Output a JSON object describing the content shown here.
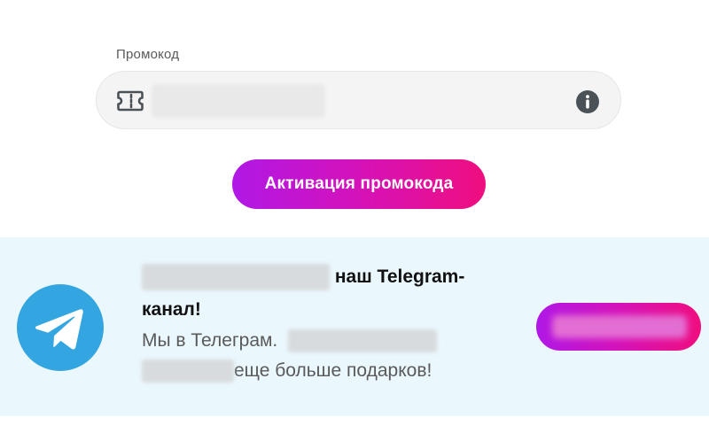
{
  "promo": {
    "label": "Промокод",
    "input_value": "",
    "ticket_icon": "ticket-icon",
    "info_icon": "info-icon"
  },
  "activate_button": {
    "label": "Активация промокода"
  },
  "telegram": {
    "title_visible": "наш Telegram-канал!",
    "desc_start": "Мы в Телеграм.",
    "desc_end": "еще больше подарков!",
    "logo_icon": "telegram-logo-icon"
  },
  "colors": {
    "accent_gradient_start": "#b018e6",
    "accent_gradient_end": "#f00e7f",
    "telegram_blue": "#33a5e0",
    "banner_bg": "#eaf7fd",
    "icon_dark": "#4b5257"
  }
}
